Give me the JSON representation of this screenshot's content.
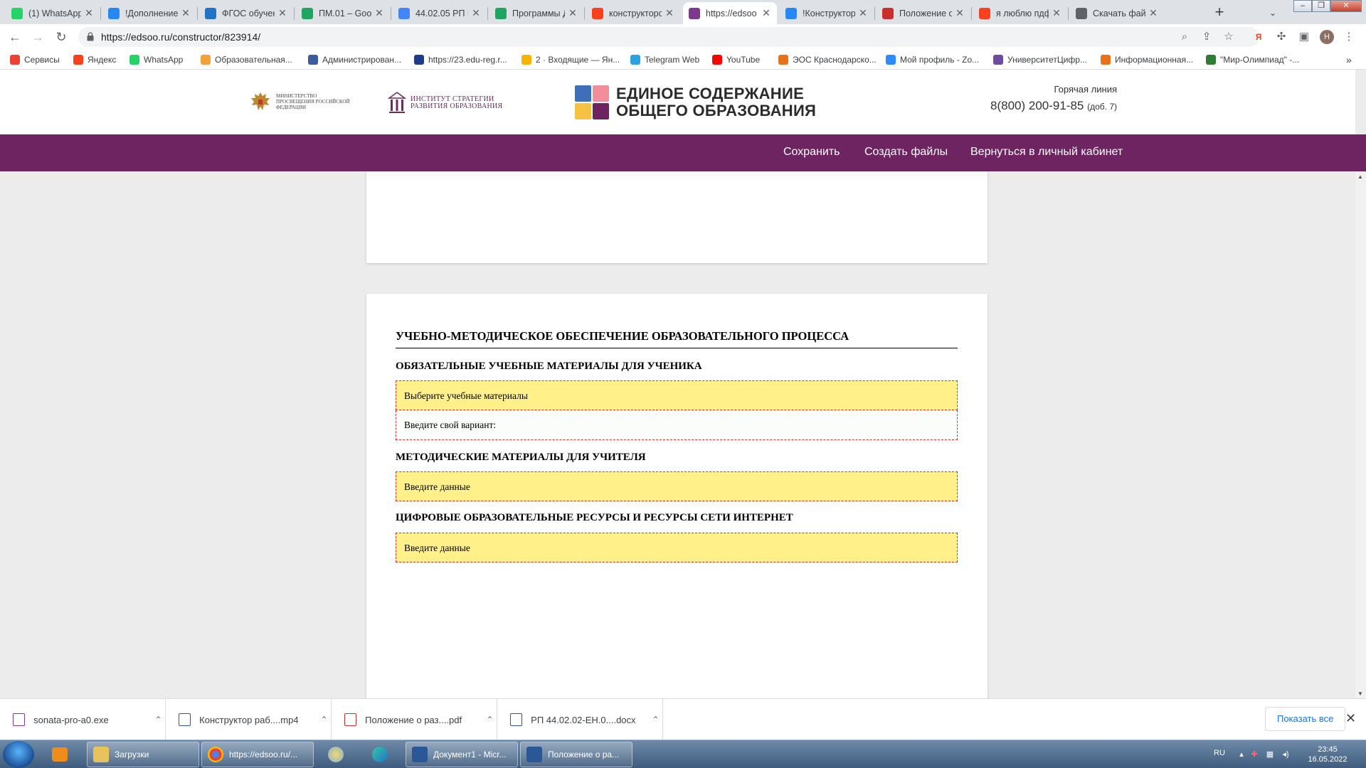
{
  "browser": {
    "tabs": [
      {
        "label": "(1) WhatsApp",
        "icon": "whatsapp-icon",
        "color": "#25d366"
      },
      {
        "label": "!Дополнение",
        "icon": "vk-icon",
        "color": "#2787f5"
      },
      {
        "label": "ФГОС обучени",
        "icon": "edge-icon",
        "color": "#1f74c8"
      },
      {
        "label": "ПМ.01 – Goog",
        "icon": "google-drive-icon",
        "color": "#1fa463"
      },
      {
        "label": "44.02.05 РП М",
        "icon": "google-docs-icon",
        "color": "#4285f4"
      },
      {
        "label": "Программы Д",
        "icon": "google-drive-icon",
        "color": "#1fa463"
      },
      {
        "label": "конструкторс",
        "icon": "yandex-icon",
        "color": "#fc3f1d"
      },
      {
        "label": "https://edsoo",
        "icon": "edsoo-icon",
        "color": "#7b3a8d"
      },
      {
        "label": "!Конструктор",
        "icon": "vk-icon",
        "color": "#2787f5"
      },
      {
        "label": "Положение о",
        "icon": "pdf-icon",
        "color": "#c9302c"
      },
      {
        "label": "я люблю пдф",
        "icon": "yandex-icon",
        "color": "#fc3f1d"
      },
      {
        "label": "Скачать файл",
        "icon": "globe-icon",
        "color": "#5f6368"
      }
    ],
    "url": "https://edsoo.ru/constructor/823914/",
    "profile_initial": "Н",
    "bookmarks": [
      {
        "label": "Сервисы",
        "icon": "apps-grid-icon",
        "color": "#ea4335"
      },
      {
        "label": "Яндекс",
        "icon": "yandex-icon",
        "color": "#fc3f1d"
      },
      {
        "label": "WhatsApp",
        "icon": "whatsapp-icon",
        "color": "#25d366"
      },
      {
        "label": "Образовательная...",
        "icon": "school-portal-icon",
        "color": "#f2a13b"
      },
      {
        "label": "Администрирован...",
        "icon": "admin-icon",
        "color": "#3b5b9d"
      },
      {
        "label": "https://23.edu-reg.r...",
        "icon": "edu-reg-icon",
        "color": "#1f3a8a"
      },
      {
        "label": "2 · Входящие — Ян...",
        "icon": "mail-icon",
        "color": "#f4b400"
      },
      {
        "label": "Telegram Web",
        "icon": "telegram-icon",
        "color": "#2aa3e0"
      },
      {
        "label": "YouTube",
        "icon": "youtube-icon",
        "color": "#ff0000"
      },
      {
        "label": "ЭОС Краснодарско...",
        "icon": "eos-icon",
        "color": "#e8711a"
      },
      {
        "label": "Мой профиль - Zo...",
        "icon": "zoom-icon",
        "color": "#2d8cff"
      },
      {
        "label": "УниверситетЦифр...",
        "icon": "university-icon",
        "color": "#6d4c9f"
      },
      {
        "label": "Информационная...",
        "icon": "info-system-icon",
        "color": "#e8711a"
      },
      {
        "label": "\"Мир-Олимпиад\" -...",
        "icon": "olympiad-icon",
        "color": "#2e7d32"
      }
    ]
  },
  "site": {
    "ministry_name": "Министерство просвещения Российской Федерации",
    "institute_name": "Институт стратегии развития образования",
    "logo_title_line1": "ЕДИНОЕ СОДЕРЖАНИЕ",
    "logo_title_line2": "ОБЩЕГО ОБРАЗОВАНИЯ",
    "logo_colors": [
      "#3f6fb6",
      "#f28e9b",
      "#f5c242",
      "#6e2461"
    ],
    "hotline_label": "Горячая линия",
    "hotline_phone": "8(800) 200-91-85",
    "hotline_ext": "(доб. 7)",
    "nav_color": "#6e2461",
    "nav": {
      "save": "Сохранить",
      "create_files": "Создать файлы",
      "back_to_account": "Вернуться в личный кабинет"
    }
  },
  "content": {
    "section_title": "УЧЕБНО-МЕТОДИЧЕСКОЕ ОБЕСПЕЧЕНИЕ ОБРАЗОВАТЕЛЬНОГО ПРОЦЕССА",
    "student_materials": {
      "heading": "ОБЯЗАТЕЛЬНЫЕ УЧЕБНЫЕ МАТЕРИАЛЫ ДЛЯ УЧЕНИКА",
      "select_placeholder": "Выберите учебные материалы",
      "custom_placeholder": "Введите свой вариант:"
    },
    "teacher_materials": {
      "heading": "МЕТОДИЧЕСКИЕ МАТЕРИАЛЫ ДЛЯ УЧИТЕЛЯ",
      "placeholder": "Введите данные"
    },
    "digital_resources": {
      "heading": "ЦИФРОВЫЕ ОБРАЗОВАТЕЛЬНЫЕ РЕСУРСЫ И РЕСУРСЫ СЕТИ ИНТЕРНЕТ",
      "placeholder": "Введите данные"
    },
    "field_highlight_color": "#fff08a",
    "field_border_color": "#d32f2f"
  },
  "downloads": {
    "items": [
      {
        "name": "sonata-pro-a0.exe",
        "icon": "exe-file-icon"
      },
      {
        "name": "Конструктор раб....mp4",
        "icon": "video-file-icon"
      },
      {
        "name": "Положение о раз....pdf",
        "icon": "pdf-file-icon"
      },
      {
        "name": "РП 44.02.02-ЕН.0....docx",
        "icon": "word-file-icon"
      }
    ],
    "show_all": "Показать все"
  },
  "taskbar": {
    "windows": [
      {
        "label": "Загрузки",
        "icon": "folder-icon"
      },
      {
        "label": "https://edsoo.ru/...",
        "icon": "chrome-icon"
      },
      {
        "label": "Документ1 - Micr...",
        "icon": "word-icon"
      },
      {
        "label": "Положение о ра...",
        "icon": "word-icon"
      }
    ],
    "language": "RU",
    "time": "23:45",
    "date": "16.05.2022"
  }
}
